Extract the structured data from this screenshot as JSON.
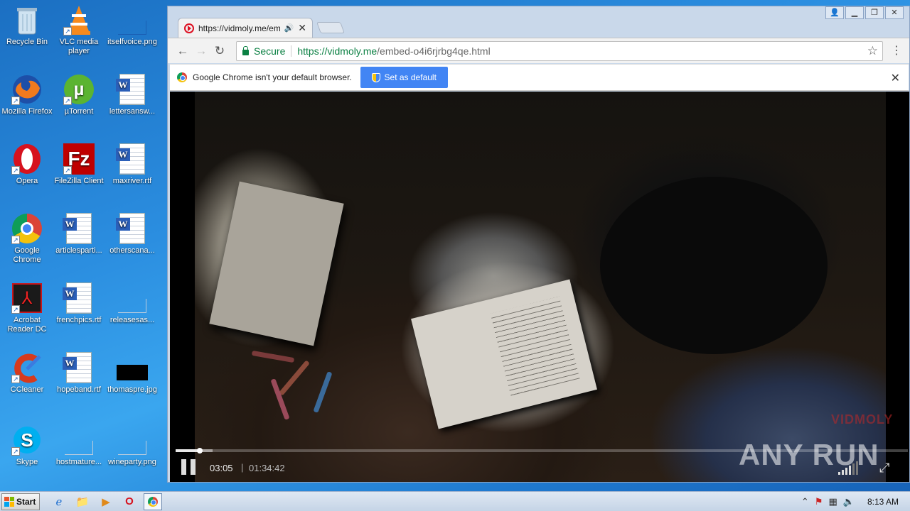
{
  "desktop": {
    "icons": [
      {
        "label": "Recycle Bin"
      },
      {
        "label": "VLC media player"
      },
      {
        "label": "itselfvoice.png"
      },
      {
        "label": "Mozilla Firefox"
      },
      {
        "label": "µTorrent"
      },
      {
        "label": "lettersansw..."
      },
      {
        "label": "Opera"
      },
      {
        "label": "FileZilla Client"
      },
      {
        "label": "maxriver.rtf"
      },
      {
        "label": "Google Chrome"
      },
      {
        "label": "articlesparti..."
      },
      {
        "label": "otherscana..."
      },
      {
        "label": "Acrobat Reader DC"
      },
      {
        "label": "frenchpics.rtf"
      },
      {
        "label": "releasesas..."
      },
      {
        "label": "CCleaner"
      },
      {
        "label": "hopeband.rtf"
      },
      {
        "label": "thomaspre.jpg"
      },
      {
        "label": "Skype"
      },
      {
        "label": "hostmature..."
      },
      {
        "label": "wineparty.png"
      }
    ]
  },
  "browser": {
    "tab": {
      "title": "https://vidmoly.me/emb",
      "audio_icon": "speaker-icon"
    },
    "omnibox": {
      "secure_label": "Secure",
      "url_scheme": "https://",
      "url_host": "vidmoly.me",
      "url_path": "/embed-o4i6rjrbg4qe.html"
    },
    "infobar": {
      "message": "Google Chrome isn't your default browser.",
      "button": "Set as default"
    }
  },
  "player": {
    "current_time": "03:05",
    "separator": "|",
    "duration": "01:34:42",
    "played_fraction": 0.033,
    "buffered_fraction": 0.05,
    "volume_level": 0.8,
    "watermark": "VIDMOLY",
    "overlay_watermark": "ANY RUN"
  },
  "taskbar": {
    "start_label": "Start",
    "clock": "8:13 AM"
  }
}
